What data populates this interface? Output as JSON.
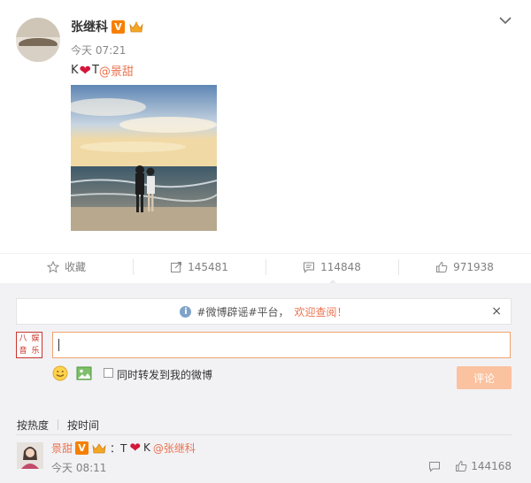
{
  "post": {
    "author_name": "张继科",
    "verified_badge": "V",
    "time": "今天 07:21",
    "content_prefix": "K",
    "content_heart": "❤",
    "content_middle": "T",
    "content_mention": "@景甜"
  },
  "actions": [
    {
      "icon": "star-icon",
      "label": "收藏"
    },
    {
      "icon": "repost-icon",
      "label": "145481"
    },
    {
      "icon": "comment-icon",
      "label": "114848"
    },
    {
      "icon": "like-icon",
      "label": "971938"
    }
  ],
  "notice": {
    "icon": "i",
    "text": "#微博辟谣#平台，",
    "link": "欢迎查阅！",
    "close": "×"
  },
  "composer": {
    "avatar_chars": [
      "八",
      "娱",
      "音",
      "乐"
    ],
    "repost_label": "同时转发到我的微博",
    "submit_label": "评论"
  },
  "sort": {
    "by_hot": "按热度",
    "by_time": "按时间"
  },
  "reply": {
    "name": "景甜",
    "verified_badge": "V",
    "colon": "：T",
    "heart": "❤",
    "k": "K",
    "mention": "@张继科",
    "time": "今天 08:11",
    "like_count": "144168"
  },
  "colors": {
    "accent": "#eb7350",
    "badge_orange": "#f77f00",
    "submit_disabled": "#fbc29f"
  }
}
